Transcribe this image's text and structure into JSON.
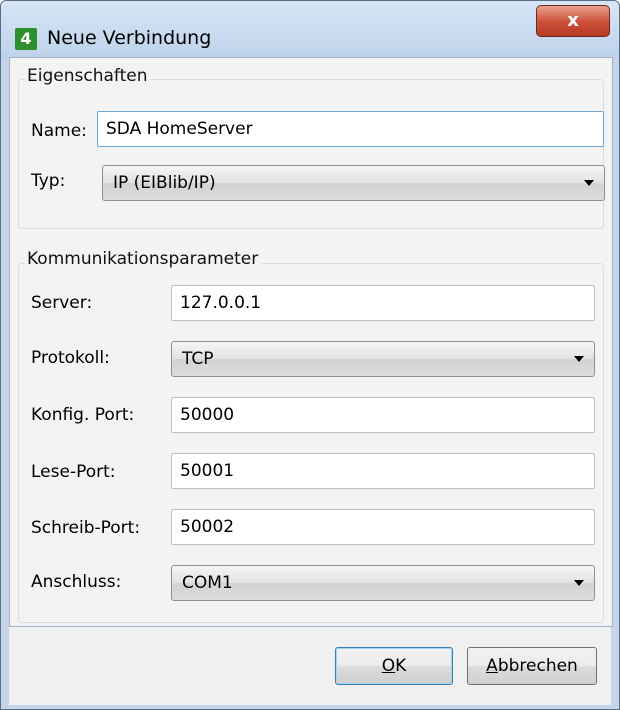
{
  "window": {
    "title": "Neue Verbindung",
    "app_icon_glyph": "4",
    "close_glyph": "x"
  },
  "eigenschaften": {
    "legend": "Eigenschaften",
    "name_label": "Name:",
    "name_value": "SDA HomeServer",
    "typ_label": "Typ:",
    "typ_value": "IP (EIBlib/IP)"
  },
  "kommunikation": {
    "legend": "Kommunikationsparameter",
    "server_label": "Server:",
    "server_value": "127.0.0.1",
    "protokoll_label": "Protokoll:",
    "protokoll_value": "TCP",
    "konfig_port_label": "Konfig. Port:",
    "konfig_port_value": "50000",
    "lese_port_label": "Lese-Port:",
    "lese_port_value": "50001",
    "schreib_port_label": "Schreib-Port:",
    "schreib_port_value": "50002",
    "anschluss_label": "Anschluss:",
    "anschluss_value": "COM1"
  },
  "buttons": {
    "ok_mnemonic": "O",
    "ok_rest": "K",
    "cancel_mnemonic": "A",
    "cancel_rest": "bbrechen"
  },
  "colors": {
    "window_frame": "#c5d6ea",
    "close_button": "#cc4f38",
    "default_button_border": "#3c7fb1",
    "focused_field_border": "#6aa7d7"
  }
}
